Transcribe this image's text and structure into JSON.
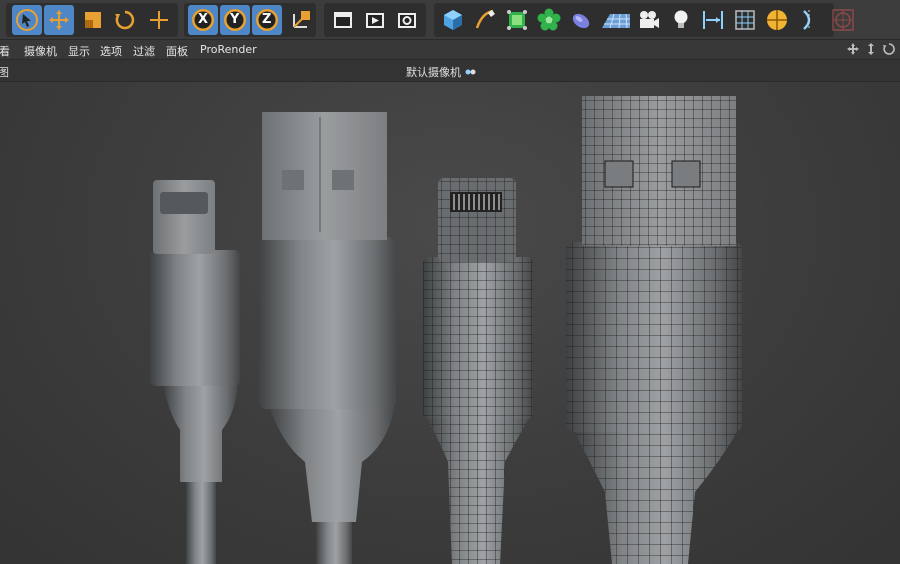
{
  "menubar": {
    "items": [
      "查看",
      "摄像机",
      "显示",
      "选项",
      "过滤",
      "面板",
      "ProRender"
    ]
  },
  "viewport": {
    "left_label": "图",
    "camera_label": "默认摄像机"
  },
  "toolbar": {
    "axis_x": "X",
    "axis_y": "Y",
    "axis_z": "Z"
  },
  "colors": {
    "toolbar_bg": "#3c3c3c",
    "active_button": "#4f86c6",
    "accent_orange": "#e8a033",
    "viewport_bg": "#3f3f3f"
  }
}
